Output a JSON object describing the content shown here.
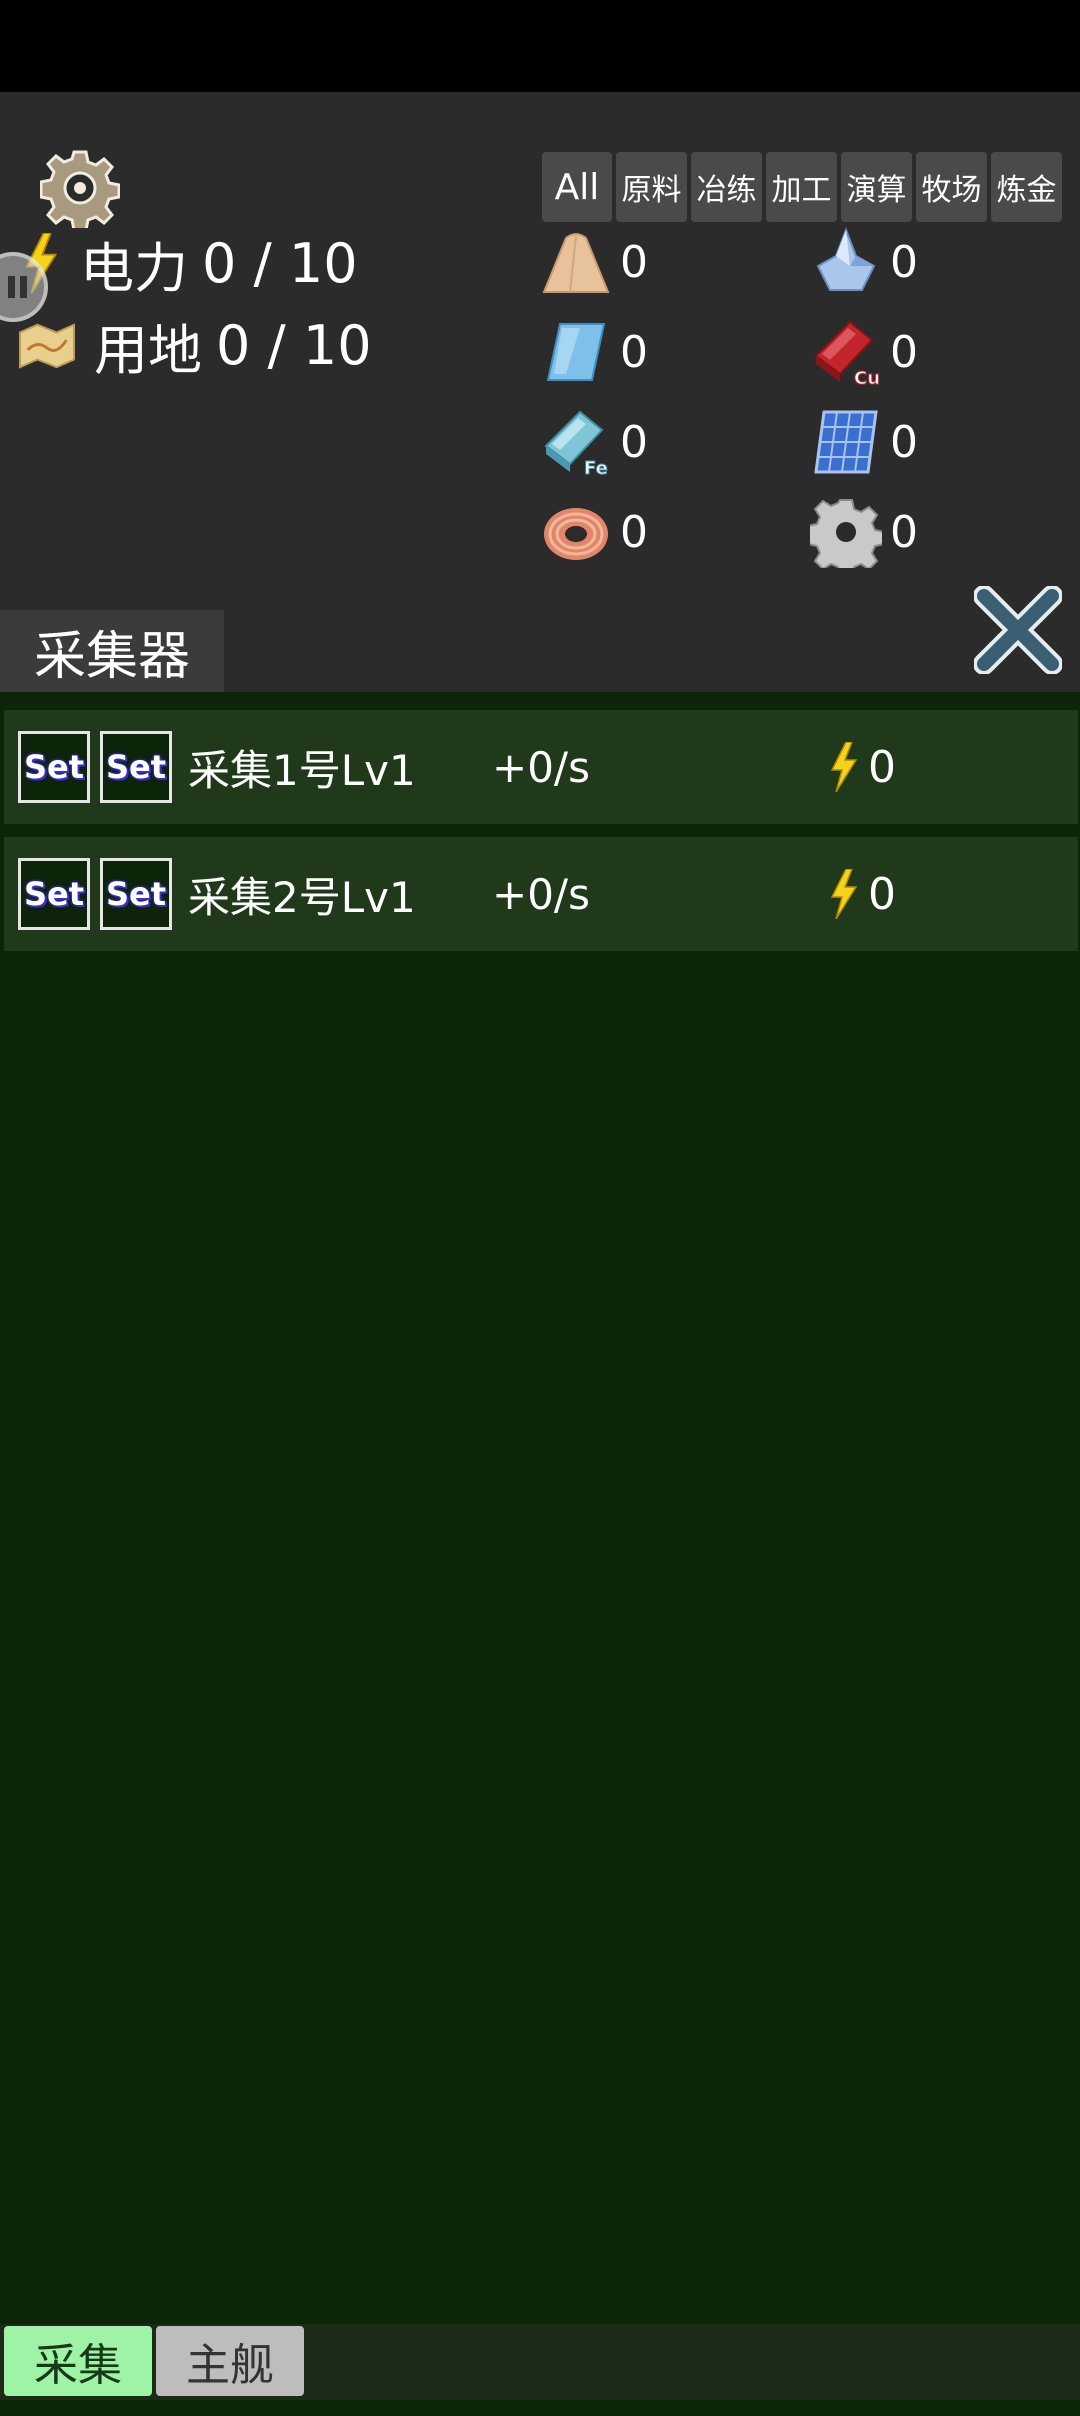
{
  "stats": {
    "power": {
      "label": "电力",
      "value": "0 / 10"
    },
    "land": {
      "label": "用地",
      "value": "0 / 10"
    }
  },
  "filter_tabs": [
    "All",
    "原料",
    "冶练",
    "加工",
    "演算",
    "牧场",
    "炼金"
  ],
  "resources": [
    {
      "icon": "sand-pile-icon",
      "count": "0"
    },
    {
      "icon": "crystal-icon",
      "count": "0"
    },
    {
      "icon": "glass-plate-icon",
      "count": "0"
    },
    {
      "icon": "copper-ingot-icon",
      "count": "0",
      "badge": "Cu"
    },
    {
      "icon": "iron-ingot-icon",
      "count": "0",
      "badge": "Fe"
    },
    {
      "icon": "solar-panel-icon",
      "count": "0"
    },
    {
      "icon": "copper-coil-icon",
      "count": "0"
    },
    {
      "icon": "gear-part-icon",
      "count": "0"
    }
  ],
  "section": {
    "title": "采集器"
  },
  "collectors": [
    {
      "set1": "Set",
      "set2": "Set",
      "name": "采集1号Lv1",
      "rate": "+0/s",
      "power": "0"
    },
    {
      "set1": "Set",
      "set2": "Set",
      "name": "采集2号Lv1",
      "rate": "+0/s",
      "power": "0"
    }
  ],
  "bottom_tabs": {
    "active": "采集",
    "inactive": "主舰"
  },
  "colors": {
    "panel": "#2b2b2b",
    "list_bg": "#0c2407",
    "row_bg": "#1f391a",
    "active_tab": "#9ff3a6",
    "close_x": "#3a5f73"
  }
}
